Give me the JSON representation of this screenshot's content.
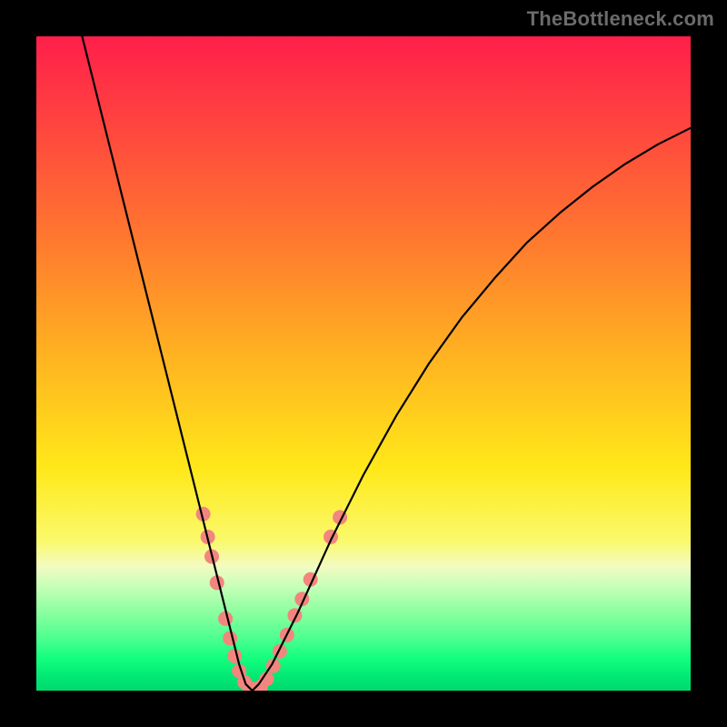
{
  "watermark": "TheBottleneck.com",
  "chart_data": {
    "type": "line",
    "title": "",
    "xlabel": "",
    "ylabel": "",
    "xlim": [
      0,
      100
    ],
    "ylim": [
      0,
      100
    ],
    "series": [
      {
        "name": "curve",
        "x": [
          7,
          10,
          13,
          16,
          19,
          21,
          23,
          25,
          27,
          28.5,
          30,
          31,
          32,
          33,
          34,
          36,
          40,
          45,
          50,
          55,
          60,
          65,
          70,
          75,
          80,
          85,
          90,
          95,
          100
        ],
        "y": [
          100,
          88,
          76,
          64,
          52,
          44,
          36,
          28,
          20,
          14,
          8,
          4,
          1,
          0,
          1,
          4,
          12,
          23,
          33,
          42,
          50,
          57,
          63,
          68.5,
          73,
          77,
          80.5,
          83.5,
          86
        ]
      }
    ],
    "markers": [
      {
        "x": 25.5,
        "y": 27.0
      },
      {
        "x": 26.2,
        "y": 23.5
      },
      {
        "x": 26.8,
        "y": 20.5
      },
      {
        "x": 27.6,
        "y": 16.5
      },
      {
        "x": 28.9,
        "y": 11.0
      },
      {
        "x": 29.6,
        "y": 8.0
      },
      {
        "x": 30.3,
        "y": 5.3
      },
      {
        "x": 31.0,
        "y": 3.0
      },
      {
        "x": 31.8,
        "y": 1.3
      },
      {
        "x": 32.6,
        "y": 0.4
      },
      {
        "x": 33.4,
        "y": 0.2
      },
      {
        "x": 34.3,
        "y": 0.6
      },
      {
        "x": 35.2,
        "y": 1.8
      },
      {
        "x": 36.2,
        "y": 3.8
      },
      {
        "x": 37.2,
        "y": 6.0
      },
      {
        "x": 38.3,
        "y": 8.5
      },
      {
        "x": 39.5,
        "y": 11.5
      },
      {
        "x": 40.6,
        "y": 14.0
      },
      {
        "x": 41.9,
        "y": 17.0
      },
      {
        "x": 45.0,
        "y": 23.5
      },
      {
        "x": 46.4,
        "y": 26.5
      }
    ],
    "marker_color": "#f2867e",
    "marker_radius": 8,
    "curve_stroke": "#000000",
    "curve_width": 2.2
  }
}
